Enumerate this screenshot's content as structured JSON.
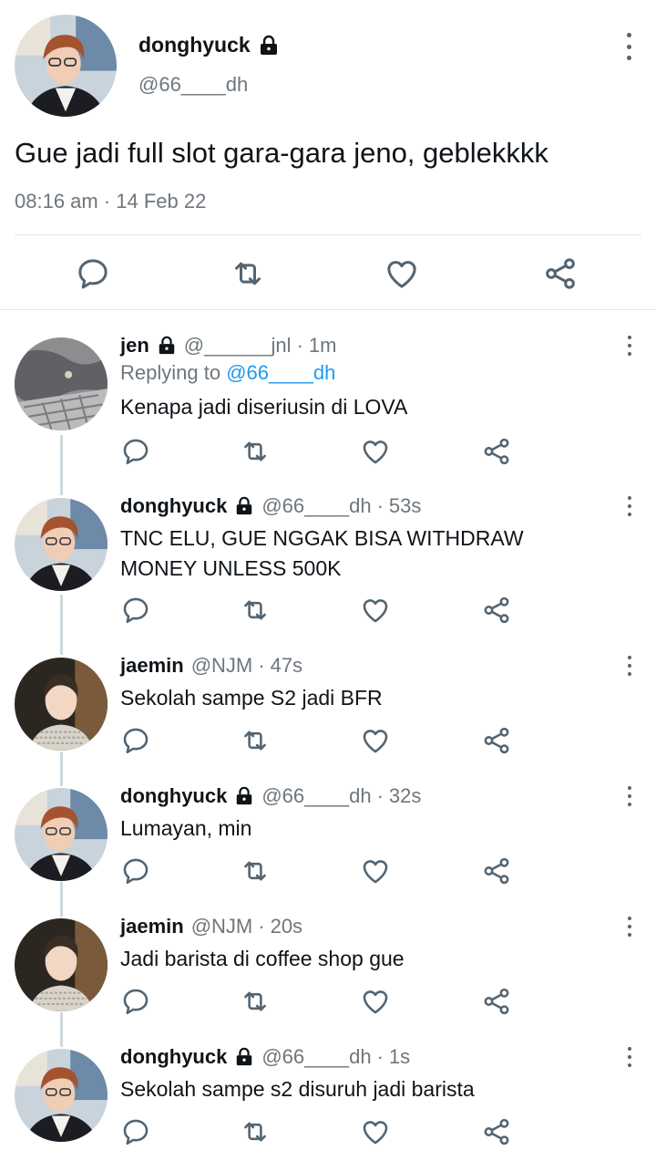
{
  "main_tweet": {
    "display_name": "donghyuck",
    "handle": "@66____dh",
    "text": "Gue jadi full slot gara-gara jeno, geblekkkk",
    "timestamp": "08:16 am · 14 Feb 22",
    "icons": [
      "reply-icon",
      "retweet-icon",
      "like-icon",
      "share-icon",
      "more-icon",
      "lock-icon"
    ]
  },
  "replies": [
    {
      "display_name": "jen",
      "handle": "@______jnl",
      "time": "1m",
      "replying_prefix": "Replying to ",
      "replying_to": "@66____dh",
      "text": "Kenapa jadi diseriusin di LOVA"
    },
    {
      "display_name": "donghyuck",
      "handle": "@66____dh",
      "time": "53s",
      "text_line1": "TNC ELU, GUE NGGAK BISA WITHDRAW",
      "text_line2": "MONEY UNLESS 500K"
    },
    {
      "display_name": "jaemin",
      "handle": "@NJM",
      "time": "47s",
      "text": "Sekolah sampe S2 jadi BFR"
    },
    {
      "display_name": "donghyuck",
      "handle": "@66____dh",
      "time": "32s",
      "text": "Lumayan, min"
    },
    {
      "display_name": "jaemin",
      "handle": "@NJM",
      "time": "20s",
      "text": "Jadi barista di coffee shop gue"
    },
    {
      "display_name": "donghyuck",
      "handle": "@66____dh",
      "time": "1s",
      "text": "Sekolah sampe s2 disuruh jadi barista"
    }
  ],
  "separator_dot": "·",
  "colors": {
    "text": "#0f1419",
    "secondary": "#6e767d",
    "link": "#1d9bf0",
    "divider": "#e1e4e6",
    "thread_line": "#cfd9de"
  }
}
